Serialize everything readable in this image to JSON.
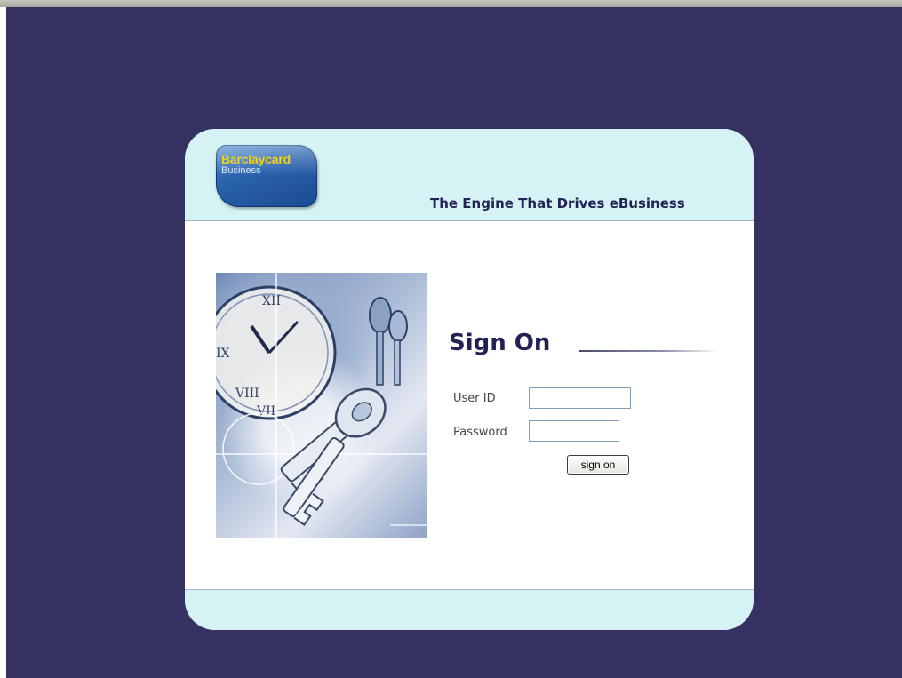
{
  "header": {
    "logo_brand": "Barclaycard",
    "logo_sub": "Business",
    "tagline": "The Engine That Drives eBusiness"
  },
  "signon": {
    "title": "Sign On",
    "user_id_label": "User ID",
    "user_id_value": "",
    "password_label": "Password",
    "password_value": "",
    "button_label": "sign on"
  },
  "colors": {
    "page_background": "#353262",
    "panel_band": "#d5f2f5",
    "heading_text": "#232255",
    "logo_yellow": "#f2d21a",
    "logo_blue": "#2b63ad"
  },
  "images": {
    "hero": "clock-and-keys-illustration",
    "logo": "barclaycard-business-logo"
  }
}
